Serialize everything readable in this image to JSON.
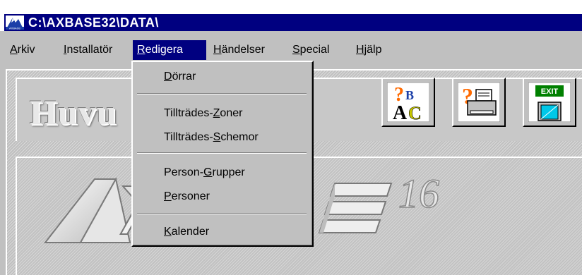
{
  "window": {
    "title": "C:\\AXBASE32\\DATA\\"
  },
  "menubar": {
    "items": [
      {
        "id": "arkiv",
        "label": "Arkiv",
        "mnemonic_index": 0,
        "active": false
      },
      {
        "id": "installator",
        "label": "Installatör",
        "mnemonic_index": 0,
        "active": false
      },
      {
        "id": "redigera",
        "label": "Redigera",
        "mnemonic_index": 0,
        "active": true
      },
      {
        "id": "handelser",
        "label": "Händelser",
        "mnemonic_index": 0,
        "active": false
      },
      {
        "id": "special",
        "label": "Special",
        "mnemonic_index": 0,
        "active": false
      },
      {
        "id": "hjalp",
        "label": "Hjälp",
        "mnemonic_index": 0,
        "active": false
      }
    ]
  },
  "dropdown": {
    "items": [
      {
        "id": "dorrar",
        "label": "Dörrar",
        "mnemonic": "D"
      },
      {
        "separator": true
      },
      {
        "id": "tilltrades-zoner",
        "label": "Tillträdes-Zoner",
        "mnemonic": "Z"
      },
      {
        "id": "tilltrades-schemor",
        "label": "Tillträdes-Schemor",
        "mnemonic": "S"
      },
      {
        "separator": true
      },
      {
        "id": "person-grupper",
        "label": "Person-Grupper",
        "mnemonic": "G"
      },
      {
        "id": "personer",
        "label": "Personer",
        "mnemonic": "P"
      },
      {
        "separator": true
      },
      {
        "id": "kalender",
        "label": "Kalender",
        "mnemonic": "K"
      }
    ]
  },
  "banner": {
    "title_visible": "Huvu"
  },
  "logo": {
    "text_left": "AX",
    "text_right": "E",
    "superscript": "16"
  },
  "toolbar": {
    "buttons": [
      {
        "id": "help-abc",
        "icon": "help-abc-icon"
      },
      {
        "id": "help-print",
        "icon": "help-printer-icon"
      },
      {
        "id": "exit",
        "icon": "exit-door-icon",
        "label": "EXIT"
      }
    ]
  },
  "colors": {
    "face": "#c0c0c0",
    "title_bar": "#000080",
    "highlight": "#000080",
    "highlight_text": "#ffffff"
  }
}
